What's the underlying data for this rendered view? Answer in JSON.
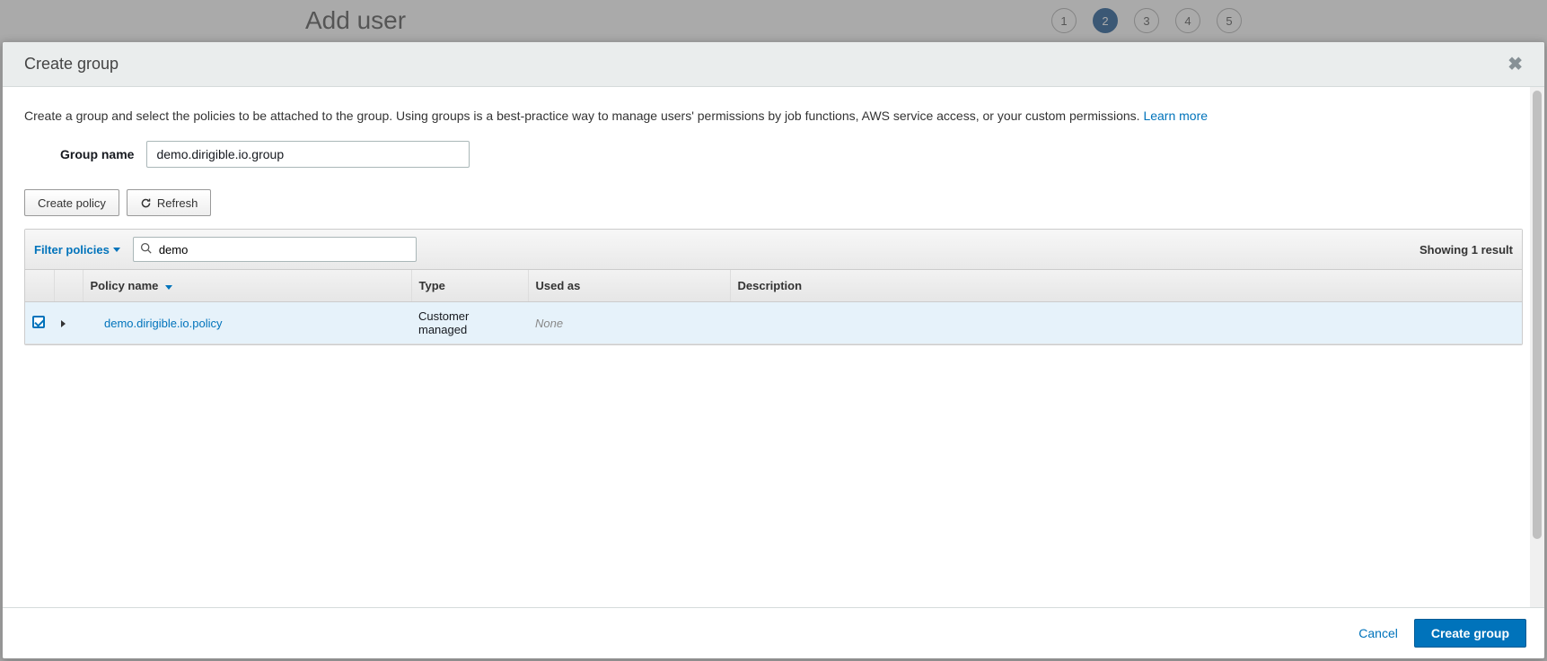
{
  "background": {
    "title": "Add user",
    "steps": [
      "1",
      "2",
      "3",
      "4",
      "5"
    ],
    "active_step_index": 1
  },
  "modal": {
    "title": "Create group",
    "description": "Create a group and select the policies to be attached to the group. Using groups is a best-practice way to manage users' permissions by job functions, AWS service access, or your custom permissions. ",
    "learn_more": "Learn more",
    "group_name_label": "Group name",
    "group_name_value": "demo.dirigible.io.group",
    "create_policy_button": "Create policy",
    "refresh_button": "Refresh",
    "filter": {
      "label": "Filter policies",
      "search_value": "demo",
      "results_text": "Showing 1 result"
    },
    "table": {
      "headers": {
        "policy_name": "Policy name",
        "type": "Type",
        "used_as": "Used as",
        "description": "Description"
      },
      "rows": [
        {
          "checked": true,
          "name": "demo.dirigible.io.policy",
          "type": "Customer managed",
          "used_as": "None",
          "description": ""
        }
      ]
    },
    "footer": {
      "cancel": "Cancel",
      "submit": "Create group"
    }
  }
}
